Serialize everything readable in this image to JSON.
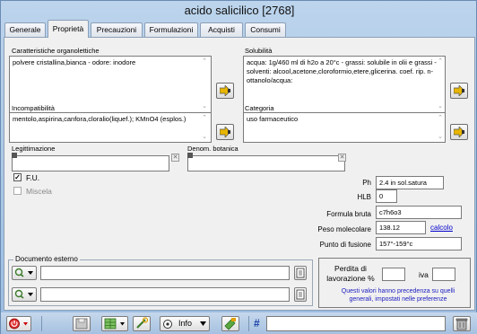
{
  "window": {
    "title": "acido salicilico  [2768]"
  },
  "tabs": [
    {
      "label": "Generale"
    },
    {
      "label": "Proprietà",
      "active": true
    },
    {
      "label": "Precauzioni"
    },
    {
      "label": "Formulazioni"
    },
    {
      "label": "Acquisti"
    },
    {
      "label": "Consumi"
    }
  ],
  "fields": {
    "organolettiche": {
      "label": "Caratteristiche organolettiche",
      "value": "polvere cristallina,bianca - odore:  inodore"
    },
    "solubilita": {
      "label": "Solubilità",
      "value": "acqua:  1g/460 ml di h2o a 20°c - grassi:  solubile in olii e grassi - solventi: alcool,acetone,cloroformio,etere,glicerina. coef. rip. n-ottanolo/acqua:"
    },
    "incompatibilita": {
      "label": "Incompatibilità",
      "value": "mentolo,aspirina,canfora,cloralio(liquef.); KMnO4 (esplos.)"
    },
    "categoria": {
      "label": "Categoria",
      "value": "uso farmaceutico"
    },
    "legittimazione": {
      "label": "Legittimazione",
      "value": ""
    },
    "denom_botanica": {
      "label": "Denom. botanica",
      "value": ""
    }
  },
  "checkboxes": {
    "fu": {
      "label": "F.U.",
      "checked": true
    },
    "miscela": {
      "label": "Miscela",
      "checked": false
    }
  },
  "properties": {
    "ph": {
      "label": "Ph",
      "value": "2.4 in sol.satura"
    },
    "hlb": {
      "label": "HLB",
      "value": "0"
    },
    "formula": {
      "label": "Formula bruta",
      "value": "c7h6o3"
    },
    "peso": {
      "label": "Peso molecolare",
      "value": "138.12",
      "link": "calcolo"
    },
    "fusione": {
      "label": "Punto di fusione",
      "value": "157°-159°c"
    }
  },
  "documento": {
    "label": "Documento esterno",
    "row1": "",
    "row2": ""
  },
  "perdita": {
    "label": "Perdita di lavorazione %",
    "value": "",
    "iva_label": "iva",
    "iva_value": "",
    "note": "Questi valori hanno precedenza su quelli generali, impostati nelle preferenze"
  },
  "toolbar": {
    "info_label": "Info",
    "hash_label": "#",
    "search_value": ""
  },
  "colors": {
    "accent": "#0000cc",
    "window_bg": "#bcd4ec"
  }
}
